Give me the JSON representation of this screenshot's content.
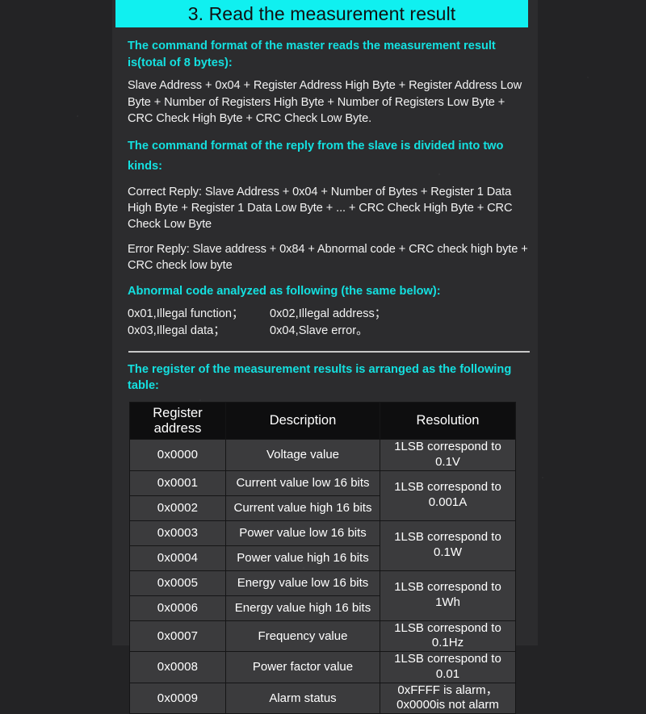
{
  "banner": {
    "title": "3. Read the measurement result"
  },
  "section_command": {
    "heading_1": "The command format of the master reads the measurement result is(total of 8 bytes):",
    "paragraph_1": "Slave Address + 0x04 + Register Address High Byte + Register Address Low Byte + Number of Registers High Byte + Number of Registers Low Byte + CRC Check High Byte + CRC Check Low Byte.",
    "heading_2": "The command format of the reply from the slave is divided into two kinds:",
    "paragraph_2": "Correct Reply: Slave Address + 0x04 + Number of Bytes + Register 1 Data High Byte + Register 1 Data Low Byte + ... + CRC Check High Byte + CRC Check Low Byte",
    "paragraph_3": "Error Reply: Slave address + 0x84 + Abnormal code + CRC check high byte + CRC check low byte",
    "heading_3": "Abnormal code analyzed as following (the same below):",
    "abnormal_codes": {
      "row1_left": "0x01,Illegal function；",
      "row1_right": "0x02,Illegal address；",
      "row2_left": "0x03,Illegal data；",
      "row2_right": "0x04,Slave error。"
    }
  },
  "section_table": {
    "heading": "The register of the measurement results is arranged as the following table:",
    "columns": [
      "Register address",
      "Description",
      "Resolution"
    ],
    "rows": [
      {
        "address": "0x0000",
        "description": "Voltage value",
        "resolution": "1LSB correspond to 0.1V"
      },
      {
        "address": "0x0001",
        "description": "Current value low 16 bits",
        "resolution": "1LSB correspond to 0.001A"
      },
      {
        "address": "0x0002",
        "description": "Current value high 16 bits",
        "resolution": ""
      },
      {
        "address": "0x0003",
        "description": "Power value low 16 bits",
        "resolution": "1LSB correspond to 0.1W"
      },
      {
        "address": "0x0004",
        "description": "Power value high 16 bits",
        "resolution": ""
      },
      {
        "address": "0x0005",
        "description": "Energy value low 16 bits",
        "resolution": "1LSB correspond to 1Wh"
      },
      {
        "address": "0x0006",
        "description": "Energy value high 16 bits",
        "resolution": ""
      },
      {
        "address": "0x0007",
        "description": "Frequency value",
        "resolution": "1LSB correspond to 0.1Hz"
      },
      {
        "address": "0x0008",
        "description": "Power factor value",
        "resolution": "1LSB correspond to 0.01"
      },
      {
        "address": "0x0009",
        "description": "Alarm status",
        "resolution": "0xFFFF is alarm，0x0000is not alarm"
      }
    ],
    "merged_resolution": {
      "current": "1LSB correspond to 0.001A",
      "power": "1LSB correspond to 0.1W",
      "energy": "1LSB correspond to 1Wh"
    },
    "alarm_resolution_line1": "0xFFFF is alarm，",
    "alarm_resolution_line2": "0x0000is not alarm"
  },
  "colors": {
    "banner_bg": "#10f0f0",
    "heading_text": "#14e0e0",
    "body_text": "#f2f2f2",
    "panel_bg": "#2c2c2e",
    "page_bg": "#232325",
    "table_header_bg": "#0e0e0f",
    "table_cell_bg": "#3b3b3d"
  }
}
